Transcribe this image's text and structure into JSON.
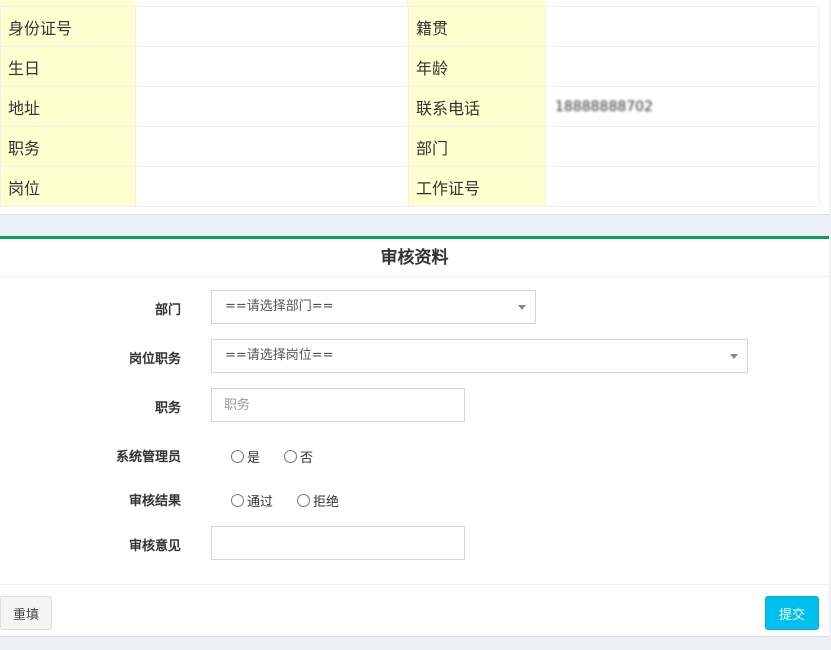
{
  "info": {
    "rows": [
      {
        "label1": "身份证号",
        "value1": "",
        "label2": "籍贯",
        "value2": ""
      },
      {
        "label1": "生日",
        "value1": "",
        "label2": "年龄",
        "value2": ""
      },
      {
        "label1": "地址",
        "value1": "",
        "label2": "联系电话",
        "value2": "18888888702"
      },
      {
        "label1": "职务",
        "value1": "",
        "label2": "部门",
        "value2": ""
      },
      {
        "label1": "岗位",
        "value1": "",
        "label2": "工作证号",
        "value2": ""
      }
    ]
  },
  "audit": {
    "title": "审核资料",
    "department": {
      "label": "部门",
      "selected": "==请选择部门=="
    },
    "position": {
      "label": "岗位职务",
      "selected": "==请选择岗位=="
    },
    "duty": {
      "label": "职务",
      "placeholder": "职务",
      "value": ""
    },
    "sysadmin": {
      "label": "系统管理员",
      "options": [
        "是",
        "否"
      ]
    },
    "result": {
      "label": "审核结果",
      "options": [
        "通过",
        "拒绝"
      ]
    },
    "opinion": {
      "label": "审核意见",
      "value": ""
    },
    "reset_label": "重填",
    "submit_label": "提交"
  },
  "colors": {
    "label_bg": "#ffffd0",
    "accent_green": "#00a65a",
    "submit_blue": "#00c0ef"
  }
}
